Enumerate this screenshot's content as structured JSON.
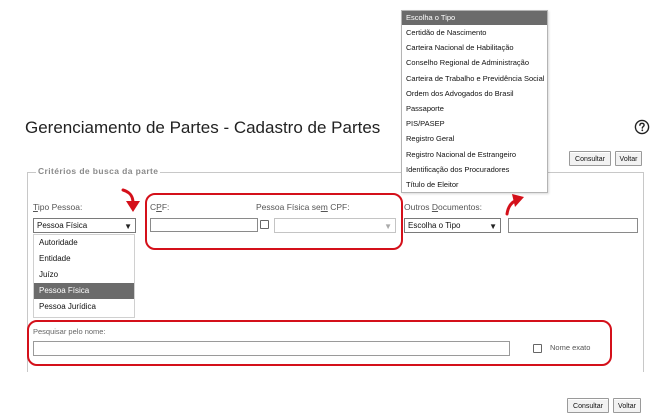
{
  "page": {
    "title": "Gerenciamento de Partes - Cadastro de Partes",
    "help_icon": "question-circle-icon"
  },
  "actions": {
    "consultar": "Consultar",
    "voltar": "Voltar"
  },
  "search_criteria": {
    "legend": "Critérios de busca da parte",
    "tipo_pessoa": {
      "label_accel": "T",
      "label_rest": "ipo Pessoa:",
      "value": "Pessoa Física",
      "options": [
        "Autoridade",
        "Entidade",
        "Juízo",
        "Pessoa Física",
        "Pessoa Jurídica"
      ],
      "selected": "Pessoa Física"
    },
    "cpf": {
      "label_pre": "C",
      "label_accel": "P",
      "label_post": "F:",
      "value": ""
    },
    "sem_cpf": {
      "label_pre": "Pessoa Física se",
      "label_accel": "m",
      "label_post": " CPF:",
      "checked": false,
      "value": ""
    },
    "outros_documentos": {
      "label_pre": "Outros ",
      "label_accel": "D",
      "label_post": "ocumentos:",
      "value": "Escolha o Tipo",
      "number": "",
      "dropdown_header": "Escolha o Tipo",
      "options": [
        "Certidão de Nascimento",
        "Carteira Nacional de Habilitação",
        "Conselho Regional de Administração",
        "Carteira de Trabalho e Previdência Social",
        "Ordem dos Advogados do Brasil",
        "Passaporte",
        "PIS/PASEP",
        "Registro Geral",
        "Registro Nacional de Estrangeiro",
        "Identificação dos Procuradores",
        "Título de Eleitor"
      ]
    },
    "nome": {
      "label": "Pesquisar pelo nome:",
      "value": "",
      "exato_label": "Nome exato",
      "exato_checked": false
    }
  },
  "annotation_color": "#d4101a"
}
